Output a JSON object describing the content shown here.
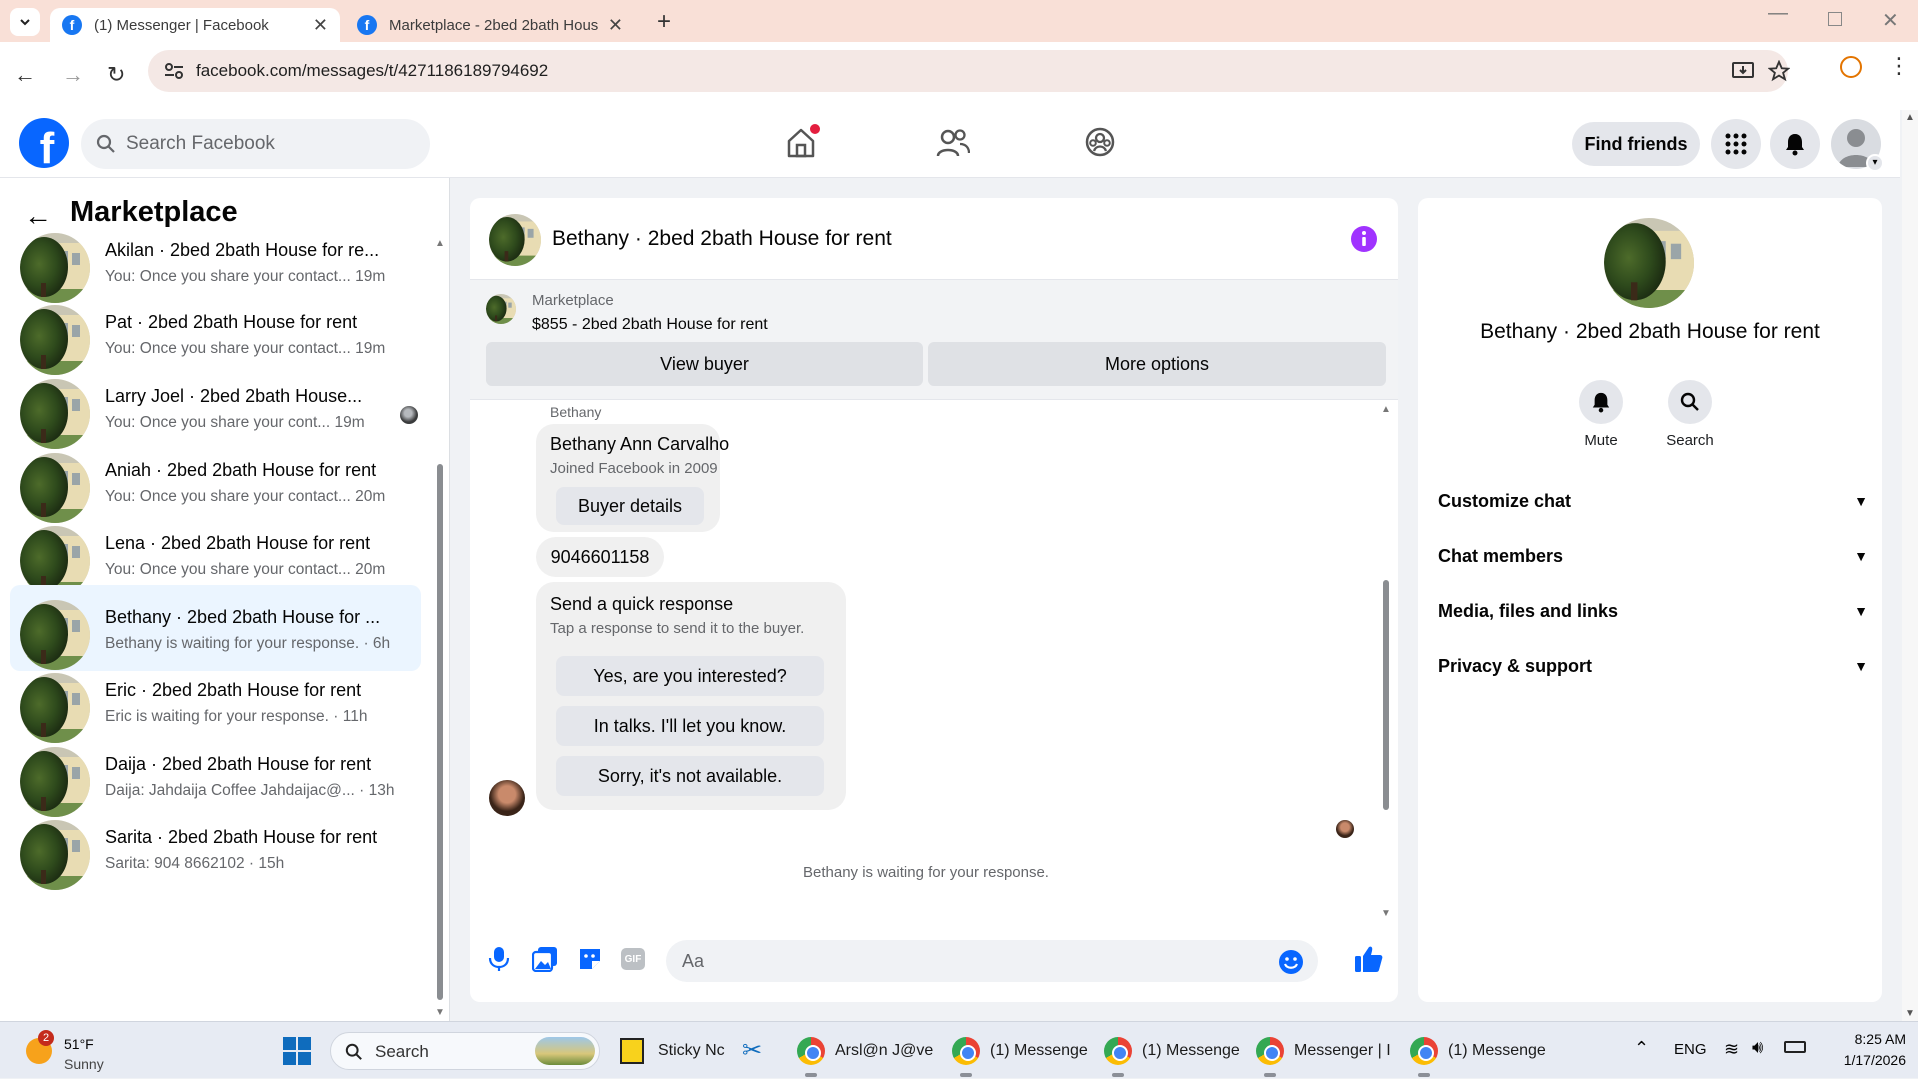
{
  "browser": {
    "tabs": [
      {
        "title": "(1) Messenger | Facebook"
      },
      {
        "title": "Marketplace - 2bed 2bath Hous"
      }
    ],
    "url": "facebook.com/messages/t/4271186189794692"
  },
  "fb_header": {
    "search_placeholder": "Search Facebook",
    "find_friends": "Find friends"
  },
  "sidebar": {
    "title": "Marketplace",
    "conversations": [
      {
        "name": "Akilan · 2bed 2bath House for re...",
        "preview": "You: Once you share your contact... 19m"
      },
      {
        "name": "Pat · 2bed 2bath House for rent",
        "preview": "You: Once you share your contact... 19m"
      },
      {
        "name": "Larry Joel · 2bed 2bath House...",
        "preview": "You: Once you share your cont... 19m"
      },
      {
        "name": "Aniah · 2bed 2bath House for rent",
        "preview": "You: Once you share your contact... 20m"
      },
      {
        "name": "Lena · 2bed 2bath House for rent",
        "preview": "You: Once you share your contact... 20m"
      },
      {
        "name": "Bethany · 2bed 2bath House for ...",
        "preview": "Bethany is waiting for your response. · 6h"
      },
      {
        "name": "Eric · 2bed 2bath House for rent",
        "preview": "Eric is waiting for your response. · 11h"
      },
      {
        "name": "Daija · 2bed 2bath House for rent",
        "preview": "Daija: Jahdaija Coffee Jahdaijac@... · 13h"
      },
      {
        "name": "Sarita · 2bed 2bath House for rent",
        "preview": "Sarita: 904 8662102 · 15h"
      }
    ]
  },
  "chat": {
    "title": "Bethany · 2bed 2bath House for rent",
    "listing_source": "Marketplace",
    "listing_title": "$855 - 2bed 2bath House for rent",
    "view_buyer": "View buyer",
    "more_options": "More options",
    "sender_label": "Bethany",
    "buyer_name": "Bethany Ann Carvalho",
    "buyer_joined": "Joined Facebook in 2009",
    "buyer_details": "Buyer details",
    "phone_message": "9046601158",
    "quick_title": "Send a quick response",
    "quick_subtitle": "Tap a response to send it to the buyer.",
    "quick_replies": [
      "Yes, are you interested?",
      "In talks. I'll let you know.",
      "Sorry, it's not available."
    ],
    "status": "Bethany is waiting for your response.",
    "composer_placeholder": "Aa"
  },
  "details": {
    "title": "Bethany · 2bed 2bath House for rent",
    "mute": "Mute",
    "search": "Search",
    "sections": [
      "Customize chat",
      "Chat members",
      "Media, files and links",
      "Privacy & support"
    ]
  },
  "taskbar": {
    "weather_temp": "51°F",
    "weather_desc": "Sunny",
    "weather_badge": "2",
    "search": "Search",
    "apps": [
      "Sticky Nc",
      "Arsl@n J@ve",
      "(1) Messenge",
      "(1) Messenge",
      "Messenger | I",
      "(1) Messenge"
    ],
    "lang": "ENG",
    "time": "8:25 AM",
    "date": "1/17/2026"
  },
  "colors": {
    "fb_blue": "#0866ff",
    "accent_purple": "#a033ff",
    "selected_row": "#ebf5ff"
  }
}
